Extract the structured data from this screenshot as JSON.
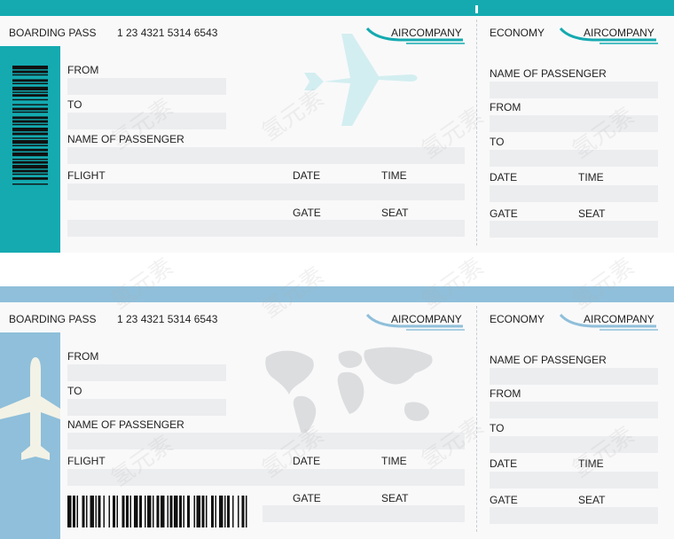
{
  "colors": {
    "ticket1_accent": "#14aab0",
    "ticket2_accent": "#8fbfda",
    "field": "#ecedef",
    "plane_light": "#d3eef0",
    "plane_cream": "#f3f2e6",
    "map": "#dcdddf"
  },
  "tickets": [
    {
      "boarding_pass_label": "BOARDING PASS",
      "ticket_number": "1 23 4321 5314 6543",
      "company": "AIRCOMPANY",
      "stub_icon": "barcode-vertical",
      "background_graphic": "airplane-icon",
      "fields": {
        "from": "FROM",
        "to": "TO",
        "name_of_passenger": "NAME OF PASSENGER",
        "flight": "FLIGHT",
        "date": "DATE",
        "time": "TIME",
        "gate": "GATE",
        "seat": "SEAT"
      },
      "coupon": {
        "class_label": "ECONOMY",
        "company": "AIRCOMPANY",
        "name_of_passenger": "NAME OF PASSENGER",
        "from": "FROM",
        "to": "TO",
        "date": "DATE",
        "time": "TIME",
        "gate": "GATE",
        "seat": "SEAT"
      }
    },
    {
      "boarding_pass_label": "BOARDING PASS",
      "ticket_number": "1 23 4321 5314 6543",
      "company": "AIRCOMPANY",
      "stub_icon": "airplane-icon",
      "background_graphic": "world-map",
      "fields": {
        "from": "FROM",
        "to": "TO",
        "name_of_passenger": "NAME OF PASSENGER",
        "flight": "FLIGHT",
        "date": "DATE",
        "time": "TIME",
        "gate": "GATE",
        "seat": "SEAT"
      },
      "coupon": {
        "class_label": "ECONOMY",
        "company": "AIRCOMPANY",
        "name_of_passenger": "NAME OF PASSENGER",
        "from": "FROM",
        "to": "TO",
        "date": "DATE",
        "time": "TIME",
        "gate": "GATE",
        "seat": "SEAT"
      }
    }
  ],
  "watermark_text": "氢元素"
}
